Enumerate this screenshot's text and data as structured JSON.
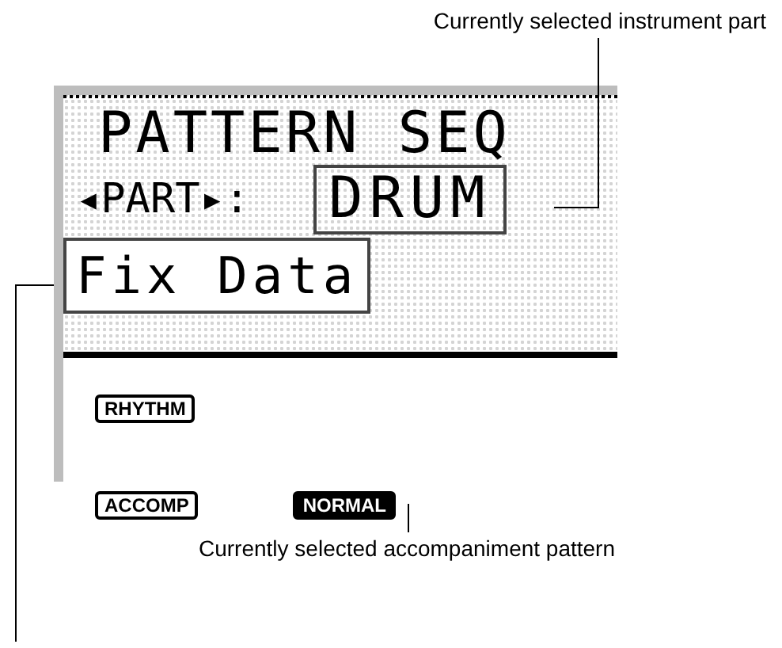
{
  "callouts": {
    "part": "Currently selected instrument part",
    "pattern": "Currently selected accompaniment pattern"
  },
  "display": {
    "title": "PATTERN SEQ",
    "part_label": "◂PART▸:",
    "part_value": "DRUM",
    "data_label": "Fix Data"
  },
  "indicators": [
    {
      "label": "RHYTHM",
      "selected": false
    },
    {
      "label": "ACCOMP",
      "selected": false
    },
    {
      "label": "NORMAL",
      "selected": true
    }
  ]
}
